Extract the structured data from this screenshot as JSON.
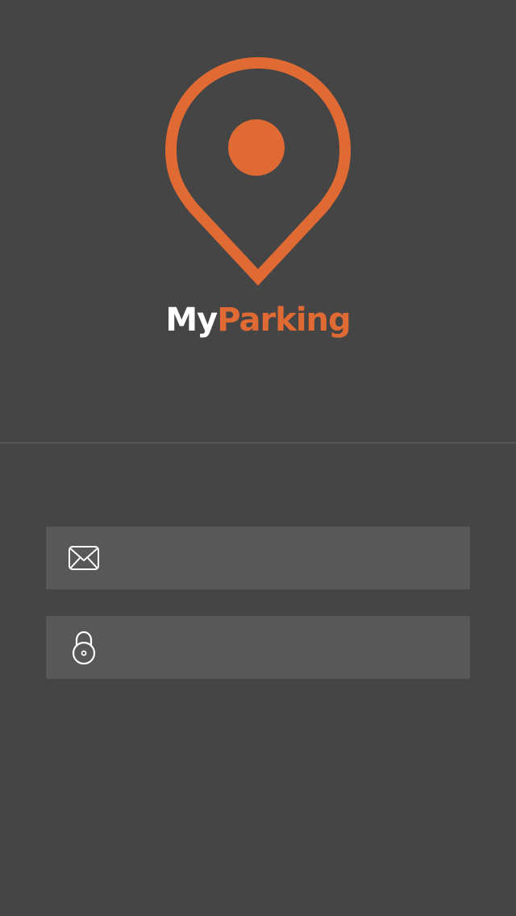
{
  "app": {
    "brand_part1": "My",
    "brand_part2": "Parking"
  },
  "colors": {
    "background": "#454545",
    "accent": "#e06a33",
    "field_background": "#585858"
  },
  "logo": {
    "icon": "location-pin-icon"
  },
  "form": {
    "email": {
      "icon": "envelope-icon",
      "value": "",
      "placeholder": ""
    },
    "password": {
      "icon": "lock-icon",
      "value": "",
      "placeholder": ""
    }
  }
}
